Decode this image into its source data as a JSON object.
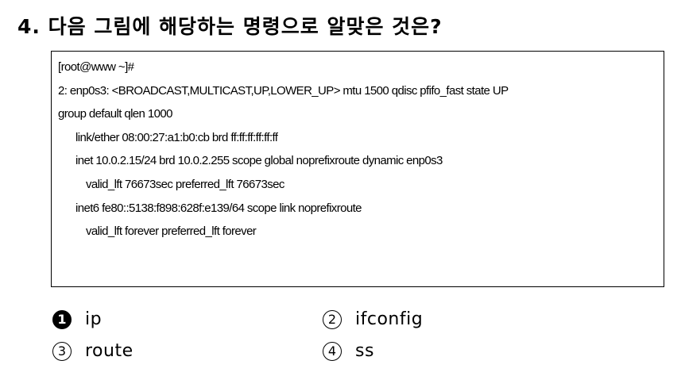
{
  "question": {
    "number": "4.",
    "text": "다음 그림에 해당하는 명령으로 알맞은 것은?"
  },
  "terminal": {
    "lines": [
      "[root@www ~]#",
      "2: enp0s3: <BROADCAST,MULTICAST,UP,LOWER_UP> mtu 1500 qdisc pfifo_fast state UP",
      "group default qlen 1000",
      "link/ether 08:00:27:a1:b0:cb brd ff:ff:ff:ff:ff:ff",
      "inet 10.0.2.15/24 brd 10.0.2.255 scope global noprefixroute dynamic enp0s3",
      "valid_lft 76673sec preferred_lft 76673sec",
      "inet6 fe80::5138:f898:628f:e139/64 scope link noprefixroute",
      "valid_lft forever preferred_lft forever"
    ]
  },
  "choices": [
    {
      "marker": "1",
      "label": "ip"
    },
    {
      "marker": "②",
      "label": "ifconfig"
    },
    {
      "marker": "③",
      "label": "route"
    },
    {
      "marker": "④",
      "label": "ss"
    }
  ]
}
